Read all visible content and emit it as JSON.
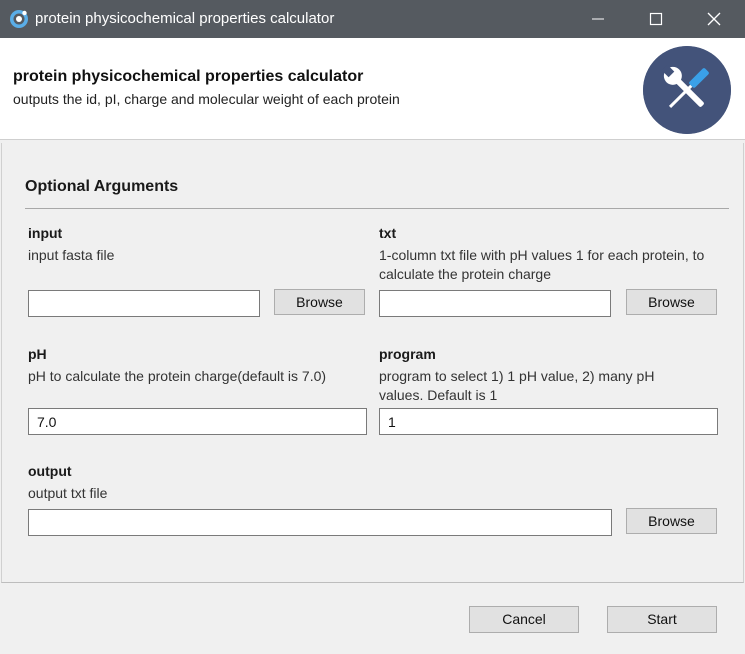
{
  "window": {
    "title": "protein physicochemical properties calculator"
  },
  "header": {
    "title": "protein physicochemical properties calculator",
    "subtitle": "outputs the id, pI, charge and molecular weight of each protein"
  },
  "section": {
    "title": "Optional Arguments"
  },
  "fields": {
    "input": {
      "label": "input",
      "help": "input fasta file",
      "value": "",
      "browse": "Browse"
    },
    "txt": {
      "label": "txt",
      "help": " 1-column txt file with pH values 1 for each protein, to calculate the protein charge",
      "value": "",
      "browse": "Browse"
    },
    "pH": {
      "label": "pH",
      "help": "pH to calculate the protein charge(default is 7.0)",
      "value": "7.0"
    },
    "program": {
      "label": "program",
      "help": "program to select 1) 1 pH value, 2) many pH values. Default is 1",
      "value": "1"
    },
    "output": {
      "label": "output",
      "help": "output txt file",
      "value": "",
      "browse": "Browse"
    }
  },
  "footer": {
    "cancel": "Cancel",
    "start": "Start"
  },
  "icons": {
    "app": "app-logo-icon",
    "header": "tools-icon"
  },
  "colors": {
    "titlebar": "#555a60",
    "icon_circle": "#43537a",
    "accent": "#3aa0e8"
  }
}
